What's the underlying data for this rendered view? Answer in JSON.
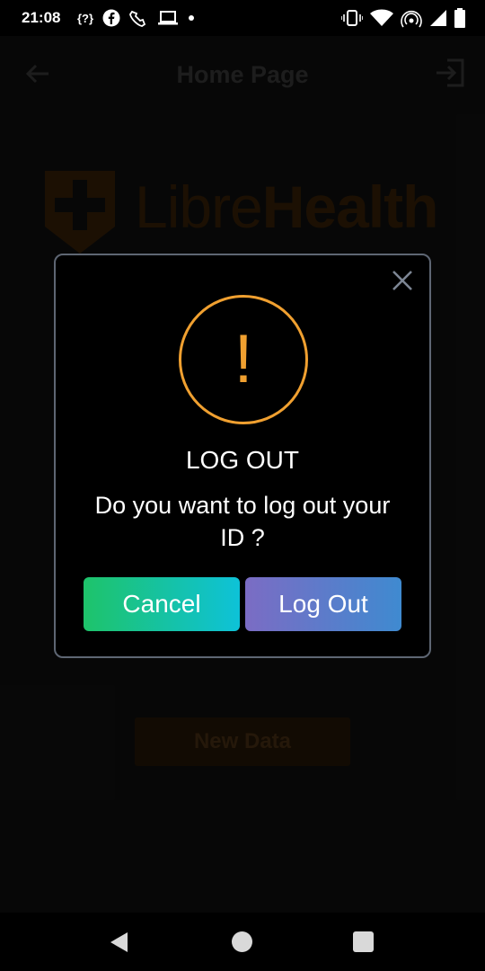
{
  "status_bar": {
    "time": "21:08",
    "left_icons": [
      "nfc-bracket-icon",
      "facebook-icon",
      "phone-tools-icon",
      "laptop-icon",
      "dot-icon"
    ],
    "right_icons": [
      "vibrate-icon",
      "wifi-icon",
      "hotspot-icon",
      "signal-icon",
      "battery-icon"
    ]
  },
  "app": {
    "title": "Home Page",
    "back_icon": "arrow-left-icon",
    "logout_icon": "logout-icon",
    "logo": {
      "text_light": "Libre",
      "text_bold": "Health"
    },
    "new_data_label": "New Data"
  },
  "dialog": {
    "close_icon": "close-icon",
    "warning_mark": "!",
    "title": "LOG OUT",
    "message": "Do you want to log out your ID ?",
    "cancel_label": "Cancel",
    "logout_label": "Log Out"
  },
  "colors": {
    "accent_orange": "#f0a030",
    "cancel_gradient": [
      "#1ec36a",
      "#0ec2d8"
    ],
    "logout_gradient": [
      "#7b6cc4",
      "#3f8ad0"
    ]
  }
}
